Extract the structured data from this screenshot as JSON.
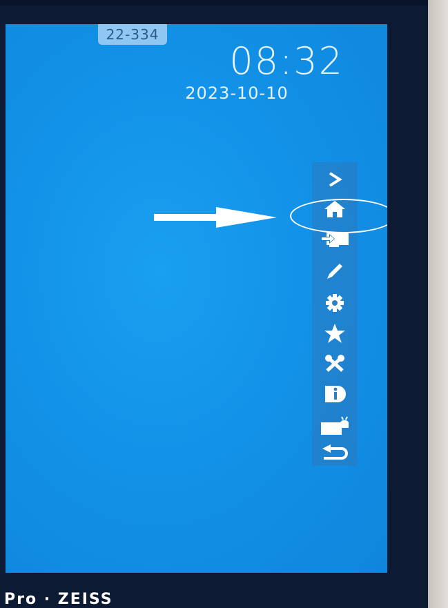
{
  "screen": {
    "room_badge": "22-334",
    "clock": "08:32",
    "date": "2023-10-10"
  },
  "sidebar": {
    "items": [
      {
        "name": "expand",
        "icon": "chevron-right-icon"
      },
      {
        "name": "home",
        "icon": "home-icon",
        "highlighted": true
      },
      {
        "name": "source-input",
        "icon": "input-source-icon"
      },
      {
        "name": "annotate",
        "icon": "pencil-icon"
      },
      {
        "name": "settings",
        "icon": "gear-icon"
      },
      {
        "name": "favorites",
        "icon": "star-icon"
      },
      {
        "name": "tools",
        "icon": "tools-icon"
      },
      {
        "name": "info",
        "icon": "info-icon"
      },
      {
        "name": "screen-share",
        "icon": "android-display-icon"
      },
      {
        "name": "back",
        "icon": "return-arrow-icon"
      }
    ]
  },
  "bezel": {
    "label": "Pro · ZEISS"
  },
  "colors": {
    "screen_blue": "#1292e8",
    "frame": "#0d1a33",
    "icon": "#ffffff"
  }
}
